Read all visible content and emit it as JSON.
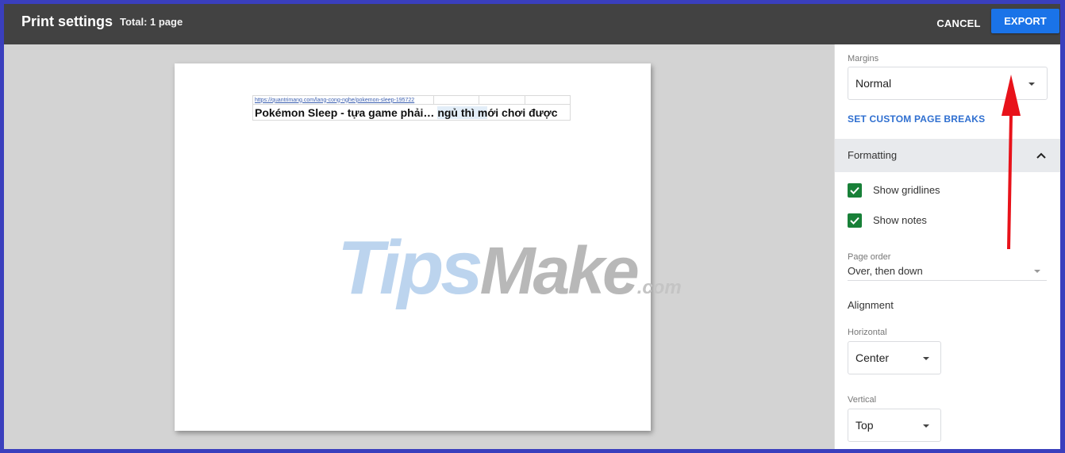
{
  "header": {
    "title": "Print settings",
    "total": "Total: 1 page",
    "cancel_label": "CANCEL",
    "export_label": "EXPORT"
  },
  "preview": {
    "link_text": "https://quantrimang.com/lang-cong-nghe/pokemon-sleep-195722",
    "title_text_a": "Pokémon Sleep - tựa game phải… ",
    "title_text_b": "ngủ thì m",
    "title_text_c": "ới chơi được",
    "watermark": {
      "tips": "Tips",
      "make": "Make",
      "com": ".com"
    }
  },
  "sidebar": {
    "margins": {
      "label": "Margins",
      "value": "Normal"
    },
    "custom_page_breaks": "SET CUSTOM PAGE BREAKS",
    "formatting": {
      "label": "Formatting",
      "expanded": true,
      "show_gridlines": {
        "label": "Show gridlines",
        "checked": true
      },
      "show_notes": {
        "label": "Show notes",
        "checked": true
      }
    },
    "page_order": {
      "label": "Page order",
      "value": "Over, then down"
    },
    "alignment": {
      "label": "Alignment",
      "horizontal": {
        "label": "Horizontal",
        "value": "Center"
      },
      "vertical": {
        "label": "Vertical",
        "value": "Top"
      }
    }
  },
  "colors": {
    "accent": "#1a73e8",
    "checkbox": "#188038",
    "annotation_arrow": "#e8121a",
    "frame": "#3a3fbd"
  }
}
